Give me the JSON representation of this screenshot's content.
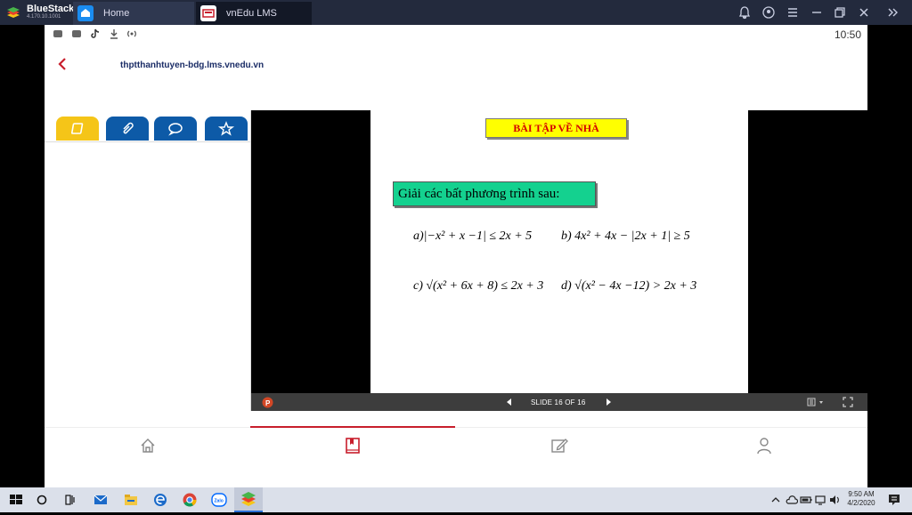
{
  "window": {
    "app_name": "BlueStacks",
    "app_version": "4.170.10.1001",
    "tabs": [
      {
        "label": "Home"
      },
      {
        "label": "vnEdu LMS"
      }
    ]
  },
  "android": {
    "clock": "10:50",
    "url": "thptthanhtuyen-bdg.lms.vnedu.vn"
  },
  "left_tabs": [
    {
      "icon": "book-icon",
      "color": "#f5c518"
    },
    {
      "icon": "paperclip-icon",
      "color": "#0d5aa7"
    },
    {
      "icon": "chat-bubble-icon",
      "color": "#0d5aa7"
    },
    {
      "icon": "star-icon",
      "color": "#0d5aa7"
    }
  ],
  "slide": {
    "title": "BÀI TẬP VỀ NHÀ",
    "task": "Giải các bất phương trình sau:",
    "equations": {
      "a": "a)|−x² + x −1| ≤ 2x + 5",
      "b": "b) 4x² + 4x − |2x + 1| ≥ 5",
      "c": "c) √(x² + 6x + 8) ≤ 2x + 3",
      "d": "d) √(x² − 4x −12) > 2x + 3"
    }
  },
  "viewer_bar": {
    "slide_counter": "SLIDE 16 OF 16"
  },
  "taskbar": {
    "time": "9:50 AM",
    "date": "4/2/2020"
  },
  "colors": {
    "title_bar": "#232a3d",
    "accent_red": "#c81e2c",
    "slide_title_bg": "#ffff00",
    "slide_task_bg": "#14d18f"
  }
}
